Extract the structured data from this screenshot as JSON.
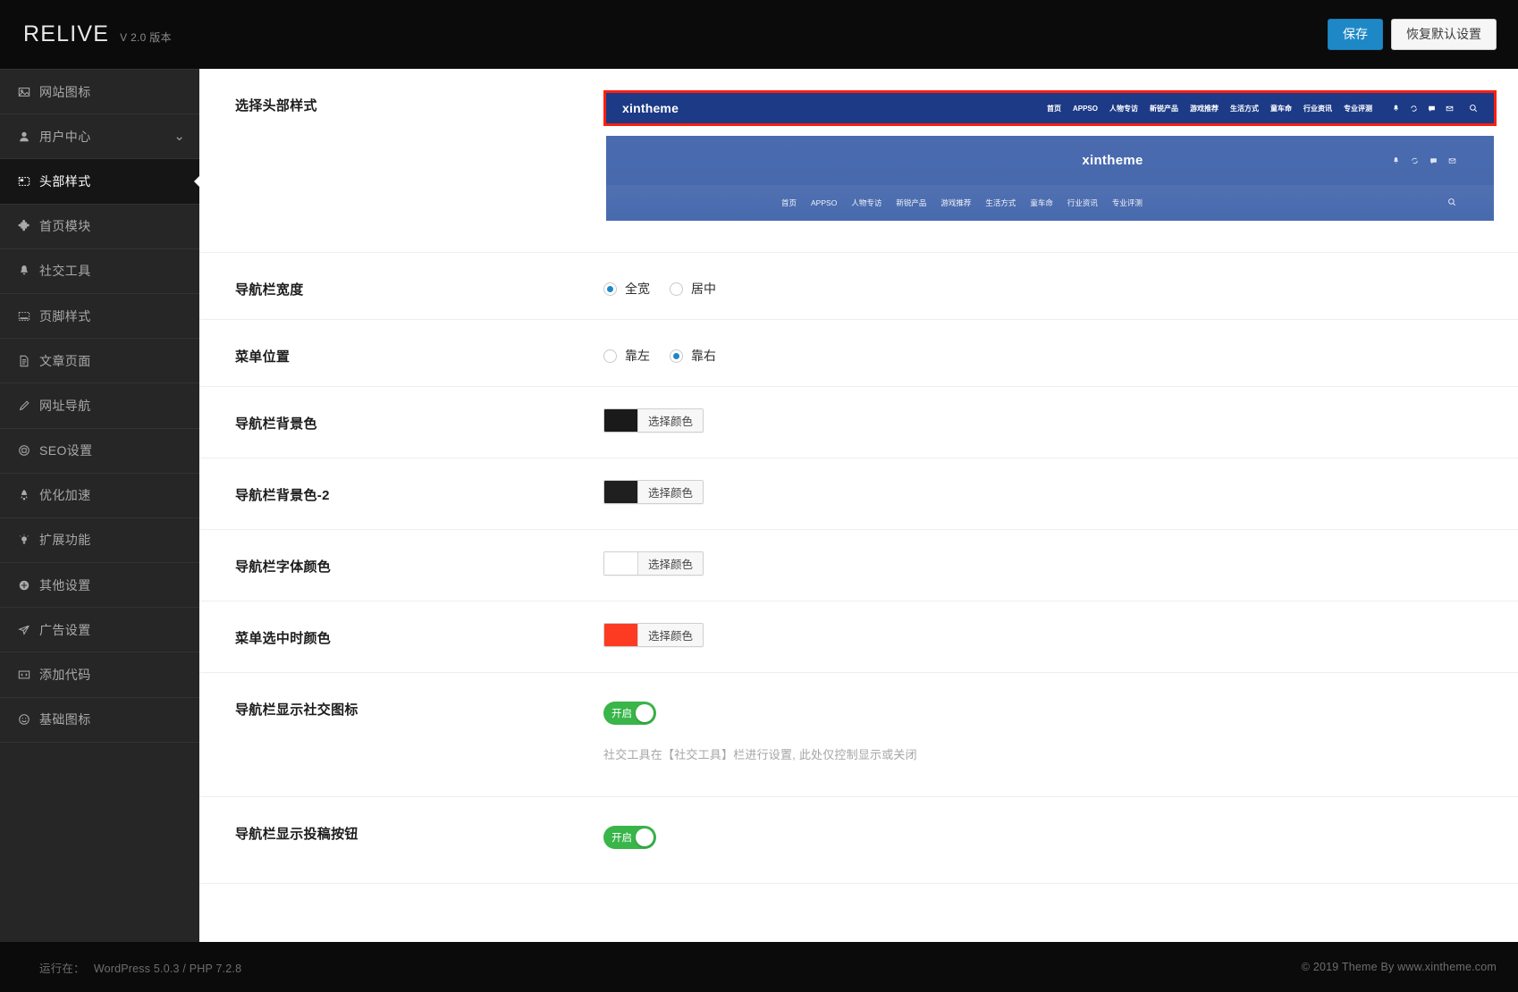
{
  "topbar": {
    "brand": "RELIVE",
    "version": "V 2.0 版本",
    "save_label": "保存",
    "reset_label": "恢复默认设置"
  },
  "sidebar": {
    "items": [
      {
        "label": "网站图标",
        "icon": "image-icon",
        "active": false,
        "expandable": false
      },
      {
        "label": "用户中心",
        "icon": "user-icon",
        "active": false,
        "expandable": true
      },
      {
        "label": "头部样式",
        "icon": "header-icon",
        "active": true,
        "expandable": false
      },
      {
        "label": "首页模块",
        "icon": "puzzle-icon",
        "active": false,
        "expandable": false
      },
      {
        "label": "社交工具",
        "icon": "bell-icon",
        "active": false,
        "expandable": false
      },
      {
        "label": "页脚样式",
        "icon": "footer-icon",
        "active": false,
        "expandable": false
      },
      {
        "label": "文章页面",
        "icon": "document-icon",
        "active": false,
        "expandable": false
      },
      {
        "label": "网址导航",
        "icon": "link-icon",
        "active": false,
        "expandable": false
      },
      {
        "label": "SEO设置",
        "icon": "target-icon",
        "active": false,
        "expandable": false
      },
      {
        "label": "优化加速",
        "icon": "rocket-icon",
        "active": false,
        "expandable": false
      },
      {
        "label": "扩展功能",
        "icon": "bulb-icon",
        "active": false,
        "expandable": false
      },
      {
        "label": "其他设置",
        "icon": "plus-circle-icon",
        "active": false,
        "expandable": false
      },
      {
        "label": "广告设置",
        "icon": "send-icon",
        "active": false,
        "expandable": false
      },
      {
        "label": "添加代码",
        "icon": "code-icon",
        "active": false,
        "expandable": false
      },
      {
        "label": "基础图标",
        "icon": "smiley-icon",
        "active": false,
        "expandable": false
      }
    ]
  },
  "fields": {
    "header_style": {
      "label": "选择头部样式",
      "options": [
        {
          "id": "style-1",
          "selected": true,
          "logo": "xintheme",
          "nav": [
            "首页",
            "APPSO",
            "人物专访",
            "新锐产品",
            "游戏推荐",
            "生活方式",
            "童车命",
            "行业资讯",
            "专业评测"
          ],
          "icons": [
            "bell-icon",
            "refresh-icon",
            "chat-icon",
            "mail-icon",
            "search-icon"
          ],
          "bg_color": "#1c3a86"
        },
        {
          "id": "style-2",
          "selected": false,
          "logo": "xintheme",
          "nav": [
            "首页",
            "APPSO",
            "人物专访",
            "新锐产品",
            "游戏推荐",
            "生活方式",
            "童车命",
            "行业资讯",
            "专业评测"
          ],
          "icons": [
            "bell-icon",
            "refresh-icon",
            "chat-icon",
            "mail-icon"
          ],
          "search_icon": "search-icon",
          "bg_color": "#4a6bae"
        }
      ]
    },
    "nav_width": {
      "label": "导航栏宽度",
      "options": [
        {
          "label": "全宽",
          "checked": true
        },
        {
          "label": "居中",
          "checked": false
        }
      ]
    },
    "menu_position": {
      "label": "菜单位置",
      "options": [
        {
          "label": "靠左",
          "checked": false
        },
        {
          "label": "靠右",
          "checked": true
        }
      ]
    },
    "nav_bg": {
      "label": "导航栏背景色",
      "color": "#1a1a1a",
      "button_label": "选择颜色"
    },
    "nav_bg_2": {
      "label": "导航栏背景色-2",
      "color": "#1f1f1f",
      "button_label": "选择颜色"
    },
    "nav_font_color": {
      "label": "导航栏字体颜色",
      "color": "#ffffff",
      "button_label": "选择颜色"
    },
    "menu_active_color": {
      "label": "菜单选中时颜色",
      "color": "#fc3b22",
      "button_label": "选择颜色"
    },
    "show_social": {
      "label": "导航栏显示社交图标",
      "toggle_label": "开启",
      "enabled": true,
      "help": "社交工具在【社交工具】栏进行设置, 此处仅控制显示或关闭"
    },
    "show_submit": {
      "label": "导航栏显示投稿按钮",
      "toggle_label": "开启",
      "enabled": true
    }
  },
  "footer": {
    "run_prefix": "运行在：",
    "run_value": "WordPress 5.0.3 / PHP 7.2.8",
    "copyright": "© 2019 Theme By www.xintheme.com"
  },
  "colors": {
    "accent": "#1e88c7",
    "toggle_on": "#39b54a",
    "selected_border": "#ff1f0f",
    "sidebar_bg": "#262626"
  }
}
